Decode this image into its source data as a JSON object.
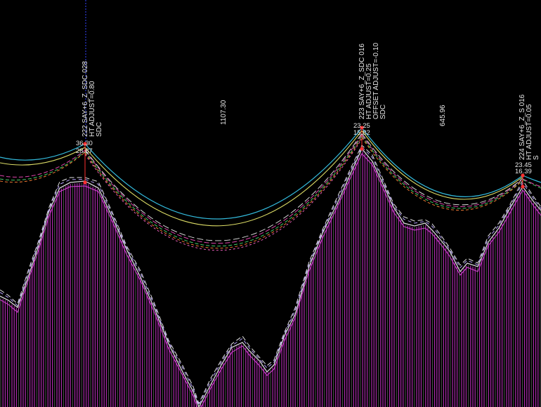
{
  "structures": [
    {
      "id": "s222",
      "lines": [
        "222 SAY+6_Z_SDC 028",
        "HT ADJUST=0.80",
        "SDC"
      ],
      "attach_height": "36.30",
      "ground_height": "28.87"
    },
    {
      "id": "s223",
      "lines": [
        "223 SAY+6_Z_SDC 016",
        "HT ADJUST=0.25",
        "OFFSET ADJUST=-0.10",
        "SDC"
      ],
      "attach_height": "23.25",
      "ground_height": "15.82"
    },
    {
      "id": "s224",
      "lines": [
        "224 SAY+6_Z_S 016",
        "HT ADJUST=0.05",
        "S"
      ],
      "attach_height": "23.45",
      "ground_height": "16.39"
    }
  ],
  "spans": [
    {
      "id": "span-222-223",
      "length": "1107.30"
    },
    {
      "id": "span-223-224",
      "length": "645.96"
    }
  ],
  "colors": {
    "background": "#000000",
    "terrain_hatch": "#cc33cc",
    "terrain_outline": "#d8d8d8",
    "wire_cyan": "#33bbdd",
    "wire_yellow": "#dddd66",
    "wire_magenta": "#dd44aa",
    "wire_green": "#44cc66",
    "wire_orange": "#ee7733",
    "structure_marker": "#ff3030",
    "centerline": "#3344ff"
  }
}
